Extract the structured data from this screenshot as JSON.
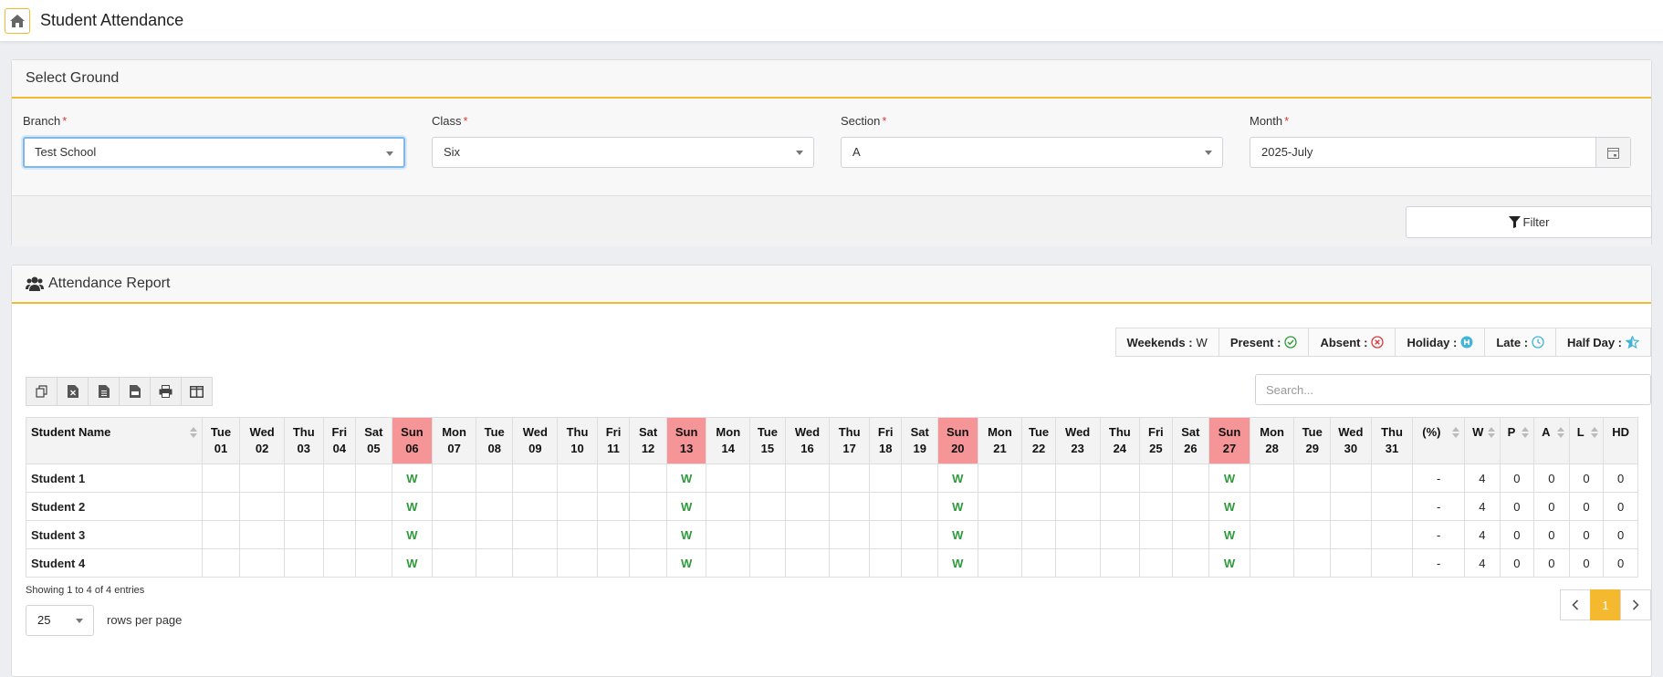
{
  "header": {
    "title": "Student Attendance",
    "home_icon": "home-icon"
  },
  "select_panel": {
    "title": "Select Ground",
    "fields": [
      {
        "label": "Branch",
        "required": "*",
        "value": "Test School"
      },
      {
        "label": "Class",
        "required": "*",
        "value": "Six"
      },
      {
        "label": "Section",
        "required": "*",
        "value": "A"
      },
      {
        "label": "Month",
        "required": "*",
        "value": "2025-July"
      }
    ],
    "filter_label": "Filter"
  },
  "report_panel": {
    "title": "Attendance Report",
    "legend": [
      {
        "label": "Weekends :",
        "symbol": "W",
        "color": "#333333"
      },
      {
        "label": "Present :",
        "icon": "check-circle-icon",
        "color": "#2e9a3a"
      },
      {
        "label": "Absent :",
        "icon": "x-circle-icon",
        "color": "#d9383a"
      },
      {
        "label": "Holiday :",
        "icon": "holiday-h-icon",
        "color": "#42b4d6"
      },
      {
        "label": "Late :",
        "icon": "clock-icon",
        "color": "#42b4d6"
      },
      {
        "label": "Half Day :",
        "icon": "half-star-icon",
        "color": "#42b4d6"
      }
    ],
    "toolbar": [
      "copy-icon",
      "excel-icon",
      "csv-icon",
      "pdf-icon",
      "print-icon",
      "columns-icon"
    ],
    "search_placeholder": "Search...",
    "table": {
      "name_header": "Student Name",
      "days": [
        {
          "d": "Tue",
          "n": "01"
        },
        {
          "d": "Wed",
          "n": "02"
        },
        {
          "d": "Thu",
          "n": "03"
        },
        {
          "d": "Fri",
          "n": "04"
        },
        {
          "d": "Sat",
          "n": "05"
        },
        {
          "d": "Sun",
          "n": "06"
        },
        {
          "d": "Mon",
          "n": "07"
        },
        {
          "d": "Tue",
          "n": "08"
        },
        {
          "d": "Wed",
          "n": "09"
        },
        {
          "d": "Thu",
          "n": "10"
        },
        {
          "d": "Fri",
          "n": "11"
        },
        {
          "d": "Sat",
          "n": "12"
        },
        {
          "d": "Sun",
          "n": "13"
        },
        {
          "d": "Mon",
          "n": "14"
        },
        {
          "d": "Tue",
          "n": "15"
        },
        {
          "d": "Wed",
          "n": "16"
        },
        {
          "d": "Thu",
          "n": "17"
        },
        {
          "d": "Fri",
          "n": "18"
        },
        {
          "d": "Sat",
          "n": "19"
        },
        {
          "d": "Sun",
          "n": "20"
        },
        {
          "d": "Mon",
          "n": "21"
        },
        {
          "d": "Tue",
          "n": "22"
        },
        {
          "d": "Wed",
          "n": "23"
        },
        {
          "d": "Thu",
          "n": "24"
        },
        {
          "d": "Fri",
          "n": "25"
        },
        {
          "d": "Sat",
          "n": "26"
        },
        {
          "d": "Sun",
          "n": "27"
        },
        {
          "d": "Mon",
          "n": "28"
        },
        {
          "d": "Tue",
          "n": "29"
        },
        {
          "d": "Wed",
          "n": "30"
        },
        {
          "d": "Thu",
          "n": "31"
        }
      ],
      "weekend_color": "#f59597",
      "summary_headers": [
        "(%)",
        "W",
        "P",
        "A",
        "L",
        "HD"
      ],
      "rows": [
        {
          "name": "Student 1",
          "weekend_mark": "W",
          "summary": [
            "-",
            "4",
            "0",
            "0",
            "0",
            "0"
          ]
        },
        {
          "name": "Student 2",
          "weekend_mark": "W",
          "summary": [
            "-",
            "4",
            "0",
            "0",
            "0",
            "0"
          ]
        },
        {
          "name": "Student 3",
          "weekend_mark": "W",
          "summary": [
            "-",
            "4",
            "0",
            "0",
            "0",
            "0"
          ]
        },
        {
          "name": "Student 4",
          "weekend_mark": "W",
          "summary": [
            "-",
            "4",
            "0",
            "0",
            "0",
            "0"
          ]
        }
      ]
    },
    "info": "Showing 1 to 4 of 4 entries",
    "rows_per_page_value": "25",
    "rows_per_page_label": "rows per page",
    "pagination": {
      "current": "1"
    }
  },
  "colors": {
    "accent": "#f5b92f",
    "present": "#2e9a3a",
    "absent": "#d9383a",
    "info": "#42b4d6"
  }
}
